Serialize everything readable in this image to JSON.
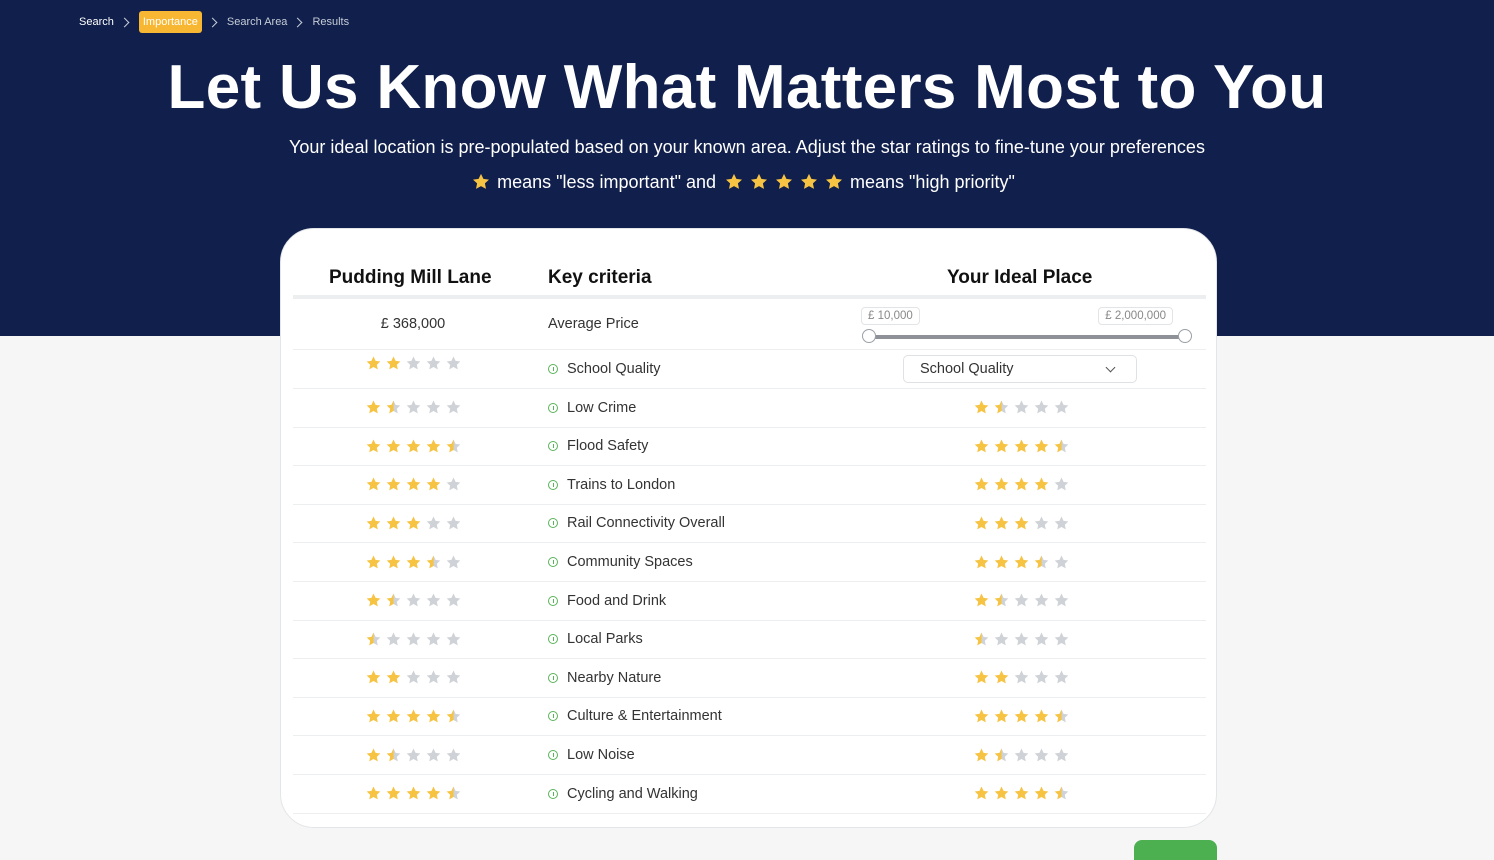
{
  "breadcrumb": [
    "Search",
    "Importance",
    "Search Area",
    "Results"
  ],
  "active_crumb_index": 1,
  "title": "Let Us Know What Matters Most to You",
  "subtitle": "Your ideal location is pre-populated based on your known area. Adjust the star ratings to fine-tune your preferences",
  "legend": {
    "low_text": "means \"less important\" and",
    "high_text": "means \"high priority\""
  },
  "table": {
    "headers": {
      "area": "Pudding Mill Lane",
      "criteria": "Key criteria",
      "ideal": "Your Ideal Place"
    },
    "price_row": {
      "area_value": "£ 368,000",
      "label": "Average Price",
      "min_label": "£ 10,000",
      "max_label": "£ 2,000,000"
    },
    "dropdown_value": "School Quality",
    "criteria": [
      {
        "label": "School Quality",
        "area_rating": 2,
        "ideal_rating": null
      },
      {
        "label": "Low Crime",
        "area_rating": 1.5,
        "ideal_rating": 1.5
      },
      {
        "label": "Flood Safety",
        "area_rating": 4.5,
        "ideal_rating": 4.5
      },
      {
        "label": "Trains to London",
        "area_rating": 4,
        "ideal_rating": 4
      },
      {
        "label": "Rail Connectivity Overall",
        "area_rating": 3,
        "ideal_rating": 3
      },
      {
        "label": "Community Spaces",
        "area_rating": 3.5,
        "ideal_rating": 3.5
      },
      {
        "label": "Food and Drink",
        "area_rating": 1.5,
        "ideal_rating": 1.5
      },
      {
        "label": "Local Parks",
        "area_rating": 0.5,
        "ideal_rating": 0.5
      },
      {
        "label": "Nearby Nature",
        "area_rating": 2,
        "ideal_rating": 2
      },
      {
        "label": "Culture & Entertainment",
        "area_rating": 4.5,
        "ideal_rating": 4.5
      },
      {
        "label": "Low Noise",
        "area_rating": 1.5,
        "ideal_rating": 1.5
      },
      {
        "label": "Cycling and Walking",
        "area_rating": 4.5,
        "ideal_rating": 4.5
      }
    ]
  },
  "colors": {
    "navy": "#101f4b",
    "accent_orange": "#f7b733",
    "star_filled": "#f6c343",
    "star_empty": "#cfd2d6",
    "info_green": "#5ab35a",
    "next_green": "#4caf50"
  },
  "icons": {
    "info": "info-circle-icon",
    "star": "star-icon",
    "chevron": "chevron-down-icon"
  }
}
